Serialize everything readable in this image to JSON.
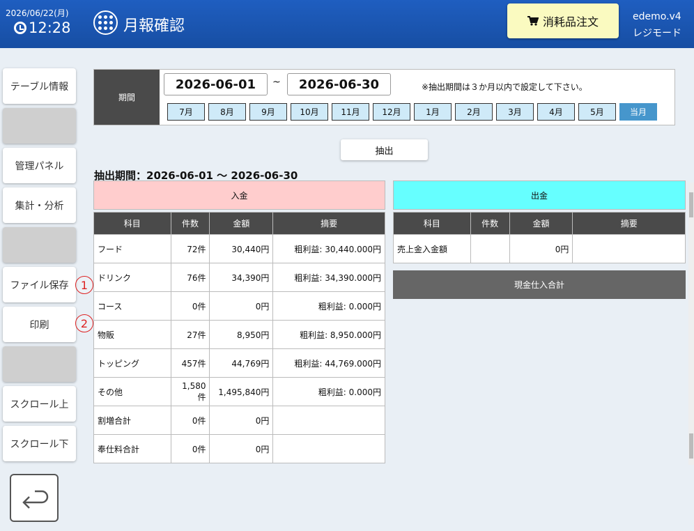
{
  "header": {
    "date": "2026/06/22(月)",
    "time": "12:28",
    "title": "月報確認",
    "order_button": "消耗品注文",
    "user_line1": "edemo.v4",
    "user_line2": "レジモード"
  },
  "sidebar": {
    "items": [
      "テーブル情報",
      "",
      "管理パネル",
      "集計・分析",
      "",
      "ファイル保存",
      "印刷",
      "",
      "スクロール上",
      "スクロール下"
    ]
  },
  "markers": [
    "1",
    "2"
  ],
  "period": {
    "label": "期間",
    "start": "2026-06-01",
    "tilde": "~",
    "end": "2026-06-30",
    "note": "※抽出期間は３か月以内で設定して下さい。",
    "months": [
      "7月",
      "8月",
      "9月",
      "10月",
      "11月",
      "12月",
      "1月",
      "2月",
      "3月",
      "4月",
      "5月",
      "当月"
    ]
  },
  "extract_button": "抽出",
  "range_text": "抽出期間：2026-06-01 ～ 2026-06-30",
  "income": {
    "title": "入金",
    "headers": [
      "科目",
      "件数",
      "金額",
      "摘要"
    ],
    "rows": [
      [
        "フード",
        "72件",
        "30,440円",
        "粗利益: 30,440.000円"
      ],
      [
        "ドリンク",
        "76件",
        "34,390円",
        "粗利益: 34,390.000円"
      ],
      [
        "コース",
        "0件",
        "0円",
        "粗利益: 0.000円"
      ],
      [
        "物販",
        "27件",
        "8,950円",
        "粗利益: 8,950.000円"
      ],
      [
        "トッピング",
        "457件",
        "44,769円",
        "粗利益: 44,769.000円"
      ],
      [
        "その他",
        "1,580件",
        "1,495,840円",
        "粗利益: 0.000円"
      ],
      [
        "割増合計",
        "0件",
        "0円",
        ""
      ],
      [
        "奉仕料合計",
        "0件",
        "0円",
        ""
      ]
    ]
  },
  "expense": {
    "title": "出金",
    "headers": [
      "科目",
      "件数",
      "金額",
      "摘要"
    ],
    "rows": [
      [
        "売上金入金額",
        "",
        "0円",
        ""
      ]
    ],
    "cash_total": "現金仕入合計"
  }
}
